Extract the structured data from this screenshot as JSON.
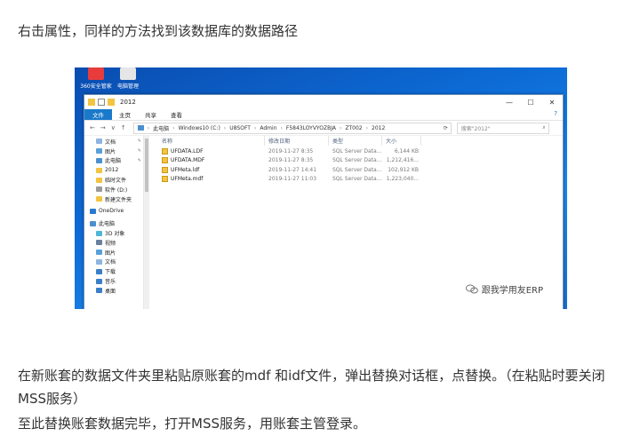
{
  "article": {
    "para1": "右击属性，同样的方法找到该数据库的数据路径",
    "para2": "在新账套的数据文件夹里粘贴原账套的mdf 和idf文件，弹出替换对话框，点替换。（在粘贴时要关闭MSS服务）",
    "para3": "至此替换账套数据完毕，打开MSS服务，用账套主管登录。"
  },
  "desktop": {
    "icons": [
      {
        "label": "360安全管家",
        "icon": "shield-icon",
        "color": "#e83c3c"
      },
      {
        "label": "电脑管理",
        "icon": "computer-icon",
        "color": "#e6e6e6"
      }
    ]
  },
  "explorer": {
    "title": "2012",
    "ribbon_tabs": [
      "文件",
      "主页",
      "共享",
      "查看"
    ],
    "nav_back": "←",
    "nav_fwd": "→",
    "nav_down": "∨",
    "nav_up": "↑",
    "breadcrumb": [
      "此电脑",
      "Windows10 (C:)",
      "U8SOFT",
      "Admin",
      "F5843LOYVYOZBJA",
      "ZT002",
      "2012"
    ],
    "search_placeholder": "搜索\"2012\"",
    "columns": {
      "name": "名称",
      "date": "修改日期",
      "type": "类型",
      "size": "大小"
    },
    "files": [
      {
        "name": "UFDATA.LDF",
        "date": "2019-11-27 8:35",
        "type": "SQL Server Data...",
        "size": "6,144 KB"
      },
      {
        "name": "UFDATA.MDF",
        "date": "2019-11-27 8:35",
        "type": "SQL Server Data...",
        "size": "1,212,416..."
      },
      {
        "name": "UFMeta.ldf",
        "date": "2019-11-27 14:41",
        "type": "SQL Server Data...",
        "size": "102,912 KB"
      },
      {
        "name": "UFMeta.mdf",
        "date": "2019-11-27 11:03",
        "type": "SQL Server Data...",
        "size": "1,223,040..."
      }
    ],
    "nav_items": [
      {
        "label": "文档",
        "level": 2,
        "pinned": true,
        "color": "#8fb4e0"
      },
      {
        "label": "图片",
        "level": 2,
        "pinned": true,
        "color": "#5aa0d8"
      },
      {
        "label": "此电脑",
        "level": 2,
        "pinned": true,
        "color": "#4a90d0"
      },
      {
        "label": "2012",
        "level": 2,
        "pinned": false,
        "color": "#f3c441"
      },
      {
        "label": "临时文件",
        "level": 2,
        "pinned": false,
        "color": "#f3c441"
      },
      {
        "label": "软件 (D:)",
        "level": 2,
        "pinned": false,
        "color": "#9a9a9a"
      },
      {
        "label": "新建文件夹",
        "level": 2,
        "pinned": false,
        "color": "#f3c441"
      },
      {
        "label": "OneDrive",
        "level": 1,
        "pinned": false,
        "color": "#2a7ad0"
      },
      {
        "label": "此电脑",
        "level": 1,
        "pinned": false,
        "color": "#4a90d0"
      },
      {
        "label": "3D 对象",
        "level": 2,
        "pinned": false,
        "color": "#4fb6d8"
      },
      {
        "label": "视频",
        "level": 2,
        "pinned": false,
        "color": "#6b7fa0"
      },
      {
        "label": "图片",
        "level": 2,
        "pinned": false,
        "color": "#5aa0d8"
      },
      {
        "label": "文档",
        "level": 2,
        "pinned": false,
        "color": "#8fb4e0"
      },
      {
        "label": "下载",
        "level": 2,
        "pinned": false,
        "color": "#3a7fc8"
      },
      {
        "label": "音乐",
        "level": 2,
        "pinned": false,
        "color": "#3a7fc8"
      },
      {
        "label": "桌面",
        "level": 2,
        "pinned": false,
        "color": "#3a7fc8"
      }
    ]
  },
  "watermark": {
    "text": "跟我学用友ERP"
  }
}
